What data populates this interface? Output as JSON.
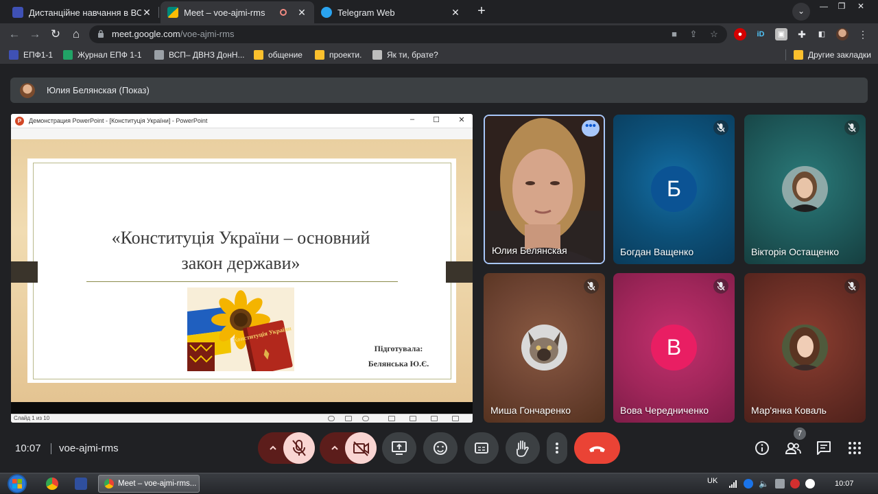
{
  "browser": {
    "tabs": [
      {
        "title": "Дистанційне навчання в ВСП",
        "favicon_color": "#3f51b5",
        "active": false
      },
      {
        "title": "Meet – voe-ajmi-rms",
        "favicon_color": "#00897b",
        "active": true,
        "recording_dot": true
      },
      {
        "title": "Telegram Web",
        "favicon_color": "#2aa3ef",
        "active": false
      }
    ],
    "new_tab_label": "+",
    "url_host": "meet.google.com",
    "url_path": "/voe-ajmi-rms",
    "bookmarks": [
      {
        "label": "ЕПФ1-1",
        "icon_color": "#3f51b5"
      },
      {
        "label": "Журнал ЕПФ 1-1",
        "icon_color": "#21a366"
      },
      {
        "label": "ВСП– ДВНЗ ДонН...",
        "icon_color": "#9aa0a6"
      },
      {
        "label": "общение",
        "icon_color": "#fbc02d"
      },
      {
        "label": "проекти.",
        "icon_color": "#fbc02d"
      },
      {
        "label": "Як ти, брате?",
        "icon_color": "#bdbdbd"
      }
    ],
    "other_bookmarks": "Другие закладки"
  },
  "meet": {
    "presenting_label": "Юлия Белянская (Показ)",
    "powerpoint": {
      "window_title": "Демонстрация PowerPoint - [Конституція України] - PowerPoint",
      "slide_title_line1": "«Конституція України – основний",
      "slide_title_line2": "закон держави»",
      "credit_line1": "Підготувала:",
      "credit_line2": "Белянська Ю.Є.",
      "book_title": "Конституція України",
      "status": "Слайд 1 из 10"
    },
    "participants": [
      {
        "name": "Юлия Белянская",
        "type": "video",
        "muted": false,
        "more_menu": true,
        "bg": "#3d2b25"
      },
      {
        "name": "Богдан Ващенко",
        "type": "letter",
        "letter": "Б",
        "muted": true,
        "bg": "#0d5a8a",
        "avatar_color": "#0b5394"
      },
      {
        "name": "Вікторія Остащенко",
        "type": "photo",
        "muted": true,
        "bg": "#1e5a5b"
      },
      {
        "name": "Миша Гончаренко",
        "type": "photo",
        "muted": true,
        "bg": "#6d4332"
      },
      {
        "name": "Вова Чередниченко",
        "type": "letter",
        "letter": "В",
        "muted": true,
        "bg": "#a0265a",
        "avatar_color": "#e91e63"
      },
      {
        "name": "Мар'янка Коваль",
        "type": "photo",
        "muted": true,
        "bg": "#6a2e25"
      }
    ],
    "time": "10:07",
    "meeting_code": "voe-ajmi-rms",
    "participant_count": "7",
    "colors": {
      "end_call": "#ea4335",
      "control_bg": "#3c4043",
      "mic_off_bg": "#f9d5d2"
    }
  },
  "taskbar": {
    "window_label": "Meet – voe-ajmi-rms...",
    "language": "UK",
    "clock": "10:07"
  }
}
